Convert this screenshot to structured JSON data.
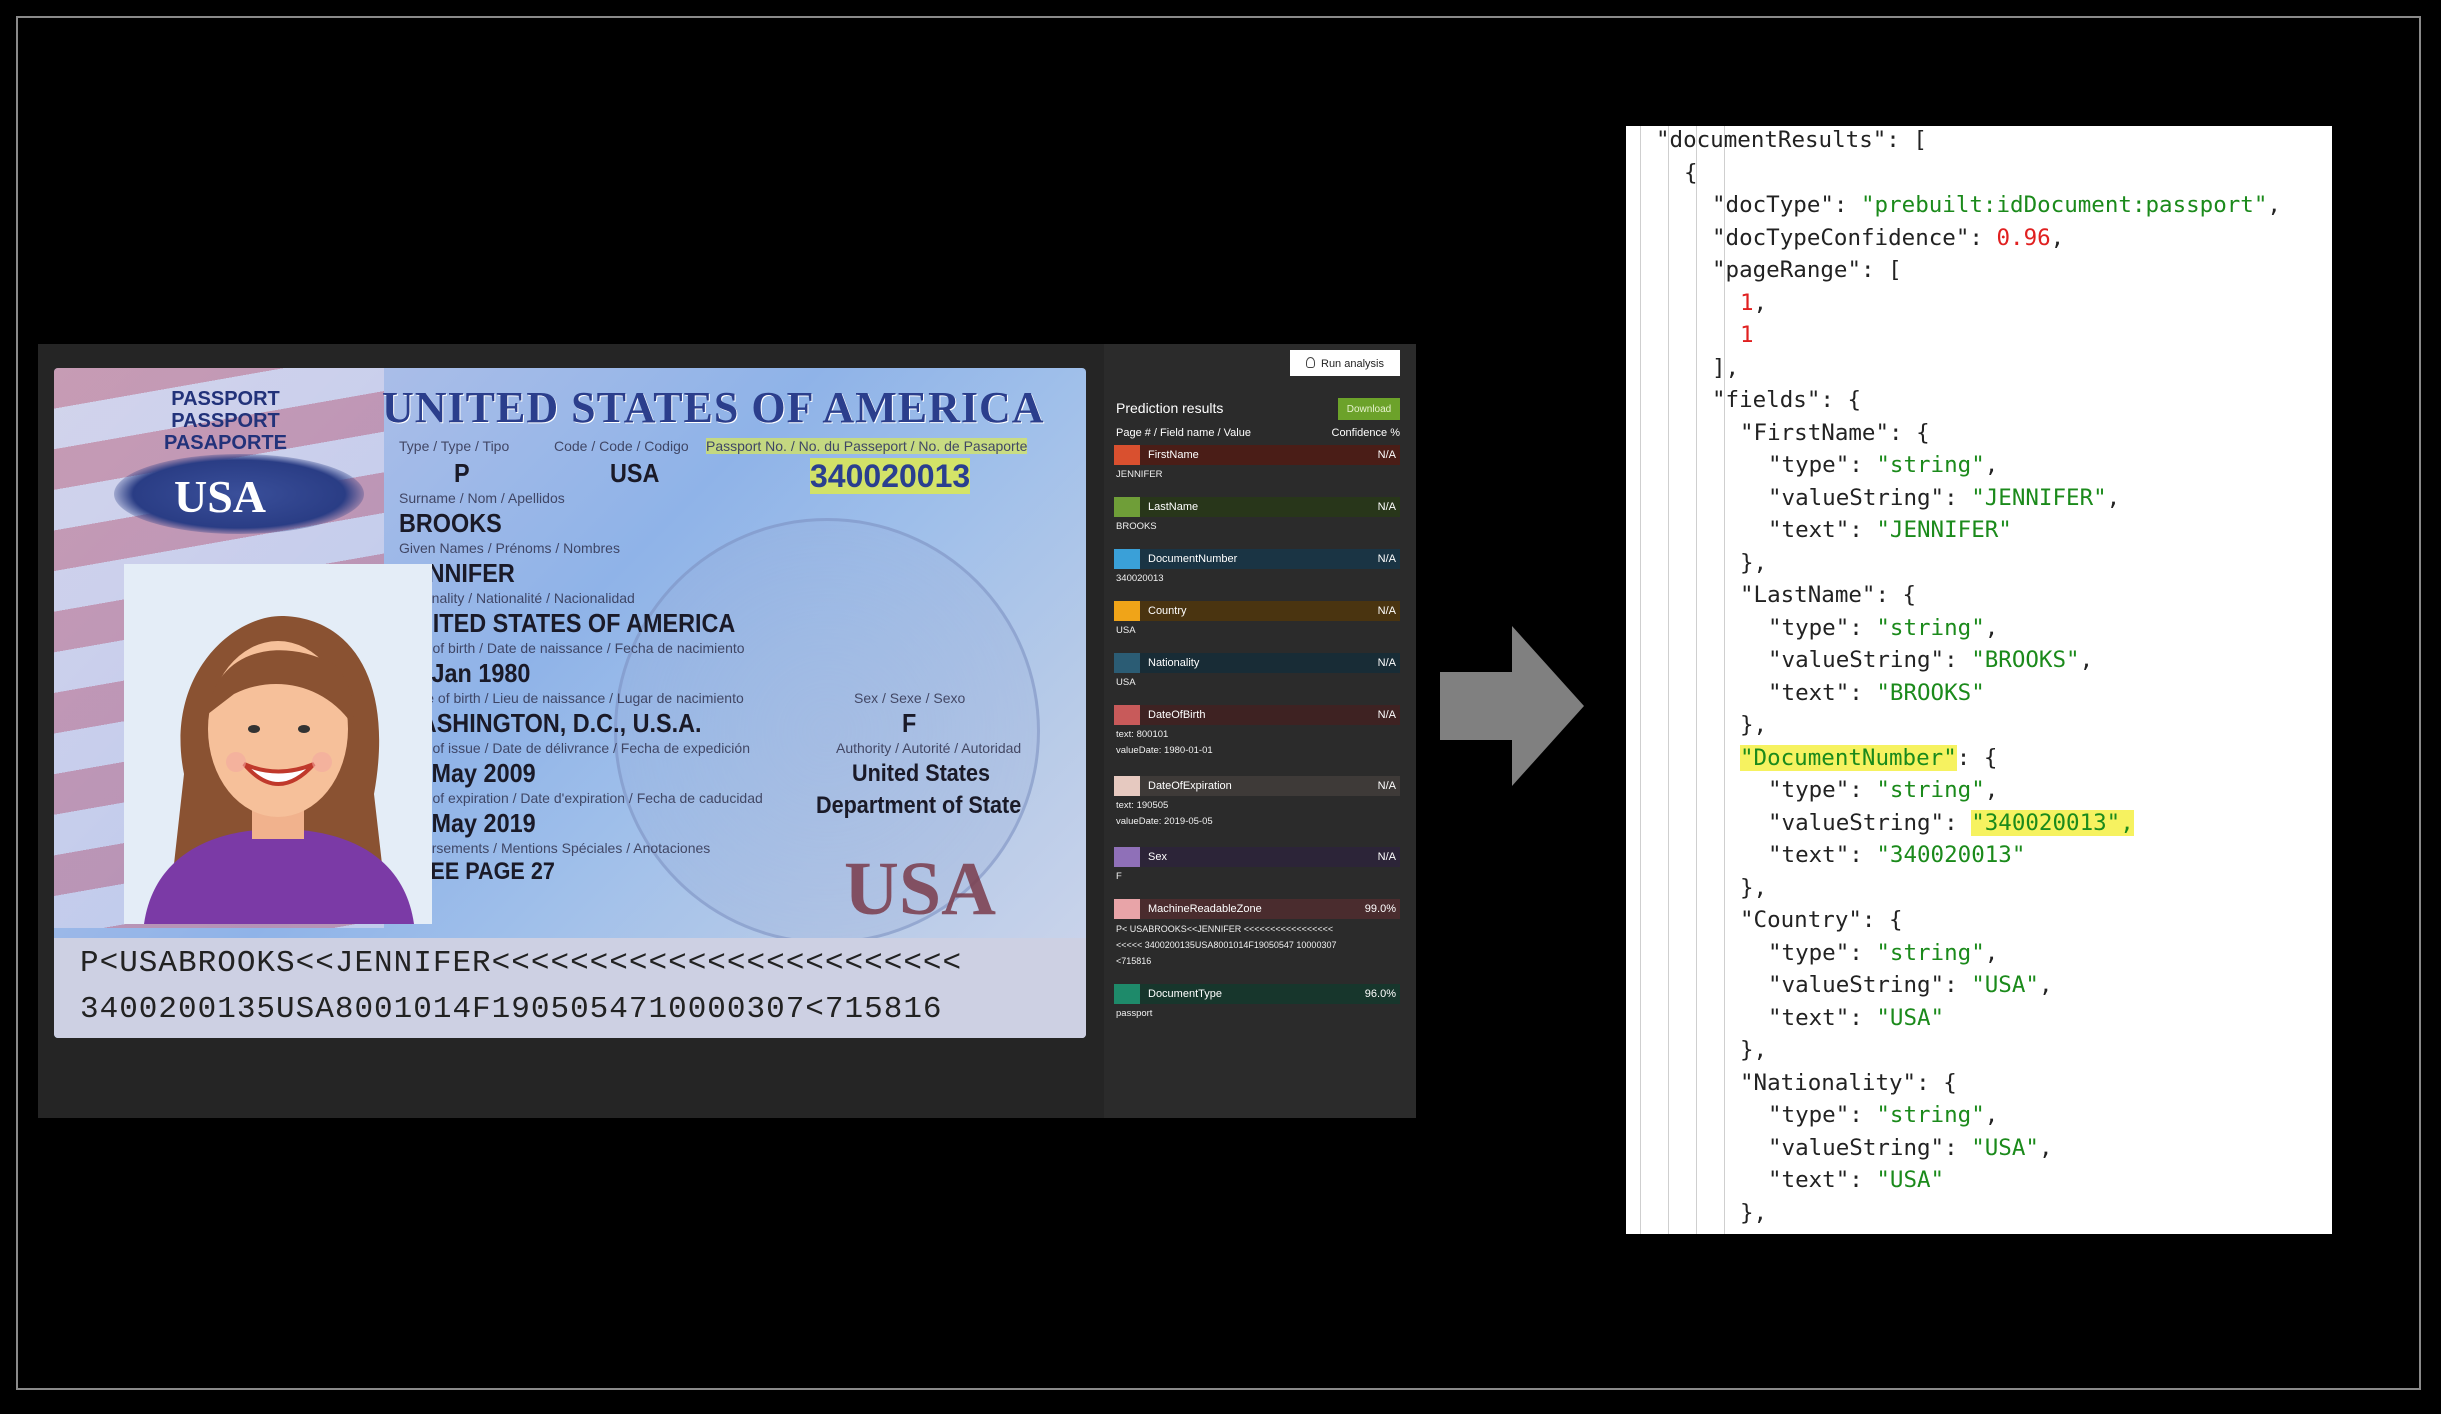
{
  "passport": {
    "header": "UNITED STATES OF AMERICA",
    "word_stack": [
      "PASSPORT",
      "PASSPORT",
      "PASAPORTE"
    ],
    "logo_text": "USA",
    "type_label": "Type / Type / Tipo",
    "code_label": "Code / Code / Codigo",
    "passport_no_label": "Passport No. / No. du Passeport / No. de Pasaporte",
    "type_value": "P",
    "code_value": "USA",
    "passport_no_value": "340020013",
    "surname_label": "Surname / Nom / Apellidos",
    "surname_value": "BROOKS",
    "given_label": "Given Names / Prénoms / Nombres",
    "given_value": "JENNIFER",
    "nationality_label": "Nationality / Nationalité / Nacionalidad",
    "nationality_value": "UNITED STATES OF AMERICA",
    "dob_label": "Date of birth / Date de naissance / Fecha de nacimiento",
    "dob_value": "01 Jan 1980",
    "pob_label": "Place of birth / Lieu de naissance / Lugar de nacimiento",
    "pob_value": "WASHINGTON, D.C., U.S.A.",
    "sex_label": "Sex / Sexe / Sexo",
    "sex_value": "F",
    "issue_label": "Date of issue / Date de délivrance / Fecha de expedición",
    "issue_value": "06 May 2009",
    "authority_label": "Authority / Autorité / Autoridad",
    "authority_value_1": "United States",
    "authority_value_2": "Department of State",
    "exp_label": "Date of expiration / Date d'expiration / Fecha de caducidad",
    "exp_value": "05 May 2019",
    "endorse_label": "Endorsements / Mentions Spéciales / Anotaciones",
    "endorse_value": "SEE PAGE 27",
    "big_usa": "USA",
    "mrz_1": "P<USABROOKS<<JENNIFER<<<<<<<<<<<<<<<<<<<<<<<<",
    "mrz_2": "3400200135USA8001014F1905054710000307<715816"
  },
  "panel": {
    "run_button": "Run analysis",
    "title": "Prediction results",
    "download_button": "Download",
    "col_left": "Page # / Field name / Value",
    "col_right": "Confidence %",
    "fields": [
      {
        "name": "FirstName",
        "conf": "N/A",
        "color": "#d9502f",
        "bg": "#4a1d17",
        "value": "JENNIFER"
      },
      {
        "name": "LastName",
        "conf": "N/A",
        "color": "#6f9e38",
        "bg": "#28361a",
        "value": "BROOKS"
      },
      {
        "name": "DocumentNumber",
        "conf": "N/A",
        "color": "#3aa0d8",
        "bg": "#1a3444",
        "value": "340020013"
      },
      {
        "name": "Country",
        "conf": "N/A",
        "color": "#f0a418",
        "bg": "#4a3410",
        "value": "USA"
      },
      {
        "name": "Nationality",
        "conf": "N/A",
        "color": "#2b5c74",
        "bg": "#182c36",
        "value": "USA"
      },
      {
        "name": "DateOfBirth",
        "conf": "N/A",
        "color": "#c85a5a",
        "bg": "#3e2222",
        "value": "text: 800101\nvalueDate: 1980-01-01"
      },
      {
        "name": "DateOfExpiration",
        "conf": "N/A",
        "color": "#e6c9c0",
        "bg": "#3e3a38",
        "value": "text: 190505\nvalueDate: 2019-05-05"
      },
      {
        "name": "Sex",
        "conf": "N/A",
        "color": "#8f70b8",
        "bg": "#2c2438",
        "value": "F"
      },
      {
        "name": "MachineReadableZone",
        "conf": "99.0%",
        "color": "#e8a4a8",
        "bg": "#4a2c2e",
        "value": "P< USABROOKS<<JENNIFER <<<<<<<<<<<<<<<<<\n<<<<< 3400200135USA8001014F19050547 10000307\n<715816"
      },
      {
        "name": "DocumentType",
        "conf": "96.0%",
        "color": "#1e8a6a",
        "bg": "#17362c",
        "value": "passport"
      }
    ]
  },
  "json_view": {
    "lines": [
      {
        "indent": 1,
        "parts": [
          {
            "t": "\"documentResults\"",
            "c": "k"
          },
          {
            "t": ": [",
            "c": "k"
          }
        ]
      },
      {
        "indent": 2,
        "parts": [
          {
            "t": "{",
            "c": "k"
          }
        ]
      },
      {
        "indent": 3,
        "parts": [
          {
            "t": "\"docType\"",
            "c": "k"
          },
          {
            "t": ": ",
            "c": "k"
          },
          {
            "t": "\"prebuilt:idDocument:passport\"",
            "c": "s"
          },
          {
            "t": ",",
            "c": "k"
          }
        ]
      },
      {
        "indent": 3,
        "parts": [
          {
            "t": "\"docTypeConfidence\"",
            "c": "k"
          },
          {
            "t": ": ",
            "c": "k"
          },
          {
            "t": "0.96",
            "c": "n"
          },
          {
            "t": ",",
            "c": "k"
          }
        ]
      },
      {
        "indent": 3,
        "parts": [
          {
            "t": "\"pageRange\"",
            "c": "k"
          },
          {
            "t": ": [",
            "c": "k"
          }
        ]
      },
      {
        "indent": 4,
        "parts": [
          {
            "t": "1",
            "c": "n"
          },
          {
            "t": ",",
            "c": "k"
          }
        ]
      },
      {
        "indent": 4,
        "parts": [
          {
            "t": "1",
            "c": "n"
          }
        ]
      },
      {
        "indent": 3,
        "parts": [
          {
            "t": "],",
            "c": "k"
          }
        ]
      },
      {
        "indent": 3,
        "parts": [
          {
            "t": "\"fields\"",
            "c": "k"
          },
          {
            "t": ": {",
            "c": "k"
          }
        ]
      },
      {
        "indent": 4,
        "parts": [
          {
            "t": "\"FirstName\"",
            "c": "k"
          },
          {
            "t": ": {",
            "c": "k"
          }
        ]
      },
      {
        "indent": 5,
        "parts": [
          {
            "t": "\"type\"",
            "c": "k"
          },
          {
            "t": ": ",
            "c": "k"
          },
          {
            "t": "\"string\"",
            "c": "s"
          },
          {
            "t": ",",
            "c": "k"
          }
        ]
      },
      {
        "indent": 5,
        "parts": [
          {
            "t": "\"valueString\"",
            "c": "k"
          },
          {
            "t": ": ",
            "c": "k"
          },
          {
            "t": "\"JENNIFER\"",
            "c": "s"
          },
          {
            "t": ",",
            "c": "k"
          }
        ]
      },
      {
        "indent": 5,
        "parts": [
          {
            "t": "\"text\"",
            "c": "k"
          },
          {
            "t": ": ",
            "c": "k"
          },
          {
            "t": "\"JENNIFER\"",
            "c": "s"
          }
        ]
      },
      {
        "indent": 4,
        "parts": [
          {
            "t": "},",
            "c": "k"
          }
        ]
      },
      {
        "indent": 4,
        "parts": [
          {
            "t": "\"LastName\"",
            "c": "k"
          },
          {
            "t": ": {",
            "c": "k"
          }
        ]
      },
      {
        "indent": 5,
        "parts": [
          {
            "t": "\"type\"",
            "c": "k"
          },
          {
            "t": ": ",
            "c": "k"
          },
          {
            "t": "\"string\"",
            "c": "s"
          },
          {
            "t": ",",
            "c": "k"
          }
        ]
      },
      {
        "indent": 5,
        "parts": [
          {
            "t": "\"valueString\"",
            "c": "k"
          },
          {
            "t": ": ",
            "c": "k"
          },
          {
            "t": "\"BROOKS\"",
            "c": "s"
          },
          {
            "t": ",",
            "c": "k"
          }
        ]
      },
      {
        "indent": 5,
        "parts": [
          {
            "t": "\"text\"",
            "c": "k"
          },
          {
            "t": ": ",
            "c": "k"
          },
          {
            "t": "\"BROOKS\"",
            "c": "s"
          }
        ]
      },
      {
        "indent": 4,
        "parts": [
          {
            "t": "},",
            "c": "k"
          }
        ]
      },
      {
        "indent": 4,
        "parts": [
          {
            "t": "\"DocumentNumber\"",
            "c": "s",
            "hl": true
          },
          {
            "t": ": {",
            "c": "k"
          }
        ]
      },
      {
        "indent": 5,
        "parts": [
          {
            "t": "\"type\"",
            "c": "k"
          },
          {
            "t": ": ",
            "c": "k"
          },
          {
            "t": "\"string\"",
            "c": "s"
          },
          {
            "t": ",",
            "c": "k"
          }
        ]
      },
      {
        "indent": 5,
        "parts": [
          {
            "t": "\"valueString\"",
            "c": "k"
          },
          {
            "t": ": ",
            "c": "k"
          },
          {
            "t": "\"340020013\",",
            "c": "s",
            "hl": true
          }
        ]
      },
      {
        "indent": 5,
        "parts": [
          {
            "t": "\"text\"",
            "c": "k"
          },
          {
            "t": ": ",
            "c": "k"
          },
          {
            "t": "\"340020013\"",
            "c": "s"
          }
        ]
      },
      {
        "indent": 4,
        "parts": [
          {
            "t": "},",
            "c": "k"
          }
        ]
      },
      {
        "indent": 4,
        "parts": [
          {
            "t": "\"Country\"",
            "c": "k"
          },
          {
            "t": ": {",
            "c": "k"
          }
        ]
      },
      {
        "indent": 5,
        "parts": [
          {
            "t": "\"type\"",
            "c": "k"
          },
          {
            "t": ": ",
            "c": "k"
          },
          {
            "t": "\"string\"",
            "c": "s"
          },
          {
            "t": ",",
            "c": "k"
          }
        ]
      },
      {
        "indent": 5,
        "parts": [
          {
            "t": "\"valueString\"",
            "c": "k"
          },
          {
            "t": ": ",
            "c": "k"
          },
          {
            "t": "\"USA\"",
            "c": "s"
          },
          {
            "t": ",",
            "c": "k"
          }
        ]
      },
      {
        "indent": 5,
        "parts": [
          {
            "t": "\"text\"",
            "c": "k"
          },
          {
            "t": ": ",
            "c": "k"
          },
          {
            "t": "\"USA\"",
            "c": "s"
          }
        ]
      },
      {
        "indent": 4,
        "parts": [
          {
            "t": "},",
            "c": "k"
          }
        ]
      },
      {
        "indent": 4,
        "parts": [
          {
            "t": "\"Nationality\"",
            "c": "k"
          },
          {
            "t": ": {",
            "c": "k"
          }
        ]
      },
      {
        "indent": 5,
        "parts": [
          {
            "t": "\"type\"",
            "c": "k"
          },
          {
            "t": ": ",
            "c": "k"
          },
          {
            "t": "\"string\"",
            "c": "s"
          },
          {
            "t": ",",
            "c": "k"
          }
        ]
      },
      {
        "indent": 5,
        "parts": [
          {
            "t": "\"valueString\"",
            "c": "k"
          },
          {
            "t": ": ",
            "c": "k"
          },
          {
            "t": "\"USA\"",
            "c": "s"
          },
          {
            "t": ",",
            "c": "k"
          }
        ]
      },
      {
        "indent": 5,
        "parts": [
          {
            "t": "\"text\"",
            "c": "k"
          },
          {
            "t": ": ",
            "c": "k"
          },
          {
            "t": "\"USA\"",
            "c": "s"
          }
        ]
      },
      {
        "indent": 4,
        "parts": [
          {
            "t": "},",
            "c": "k"
          }
        ]
      }
    ]
  }
}
